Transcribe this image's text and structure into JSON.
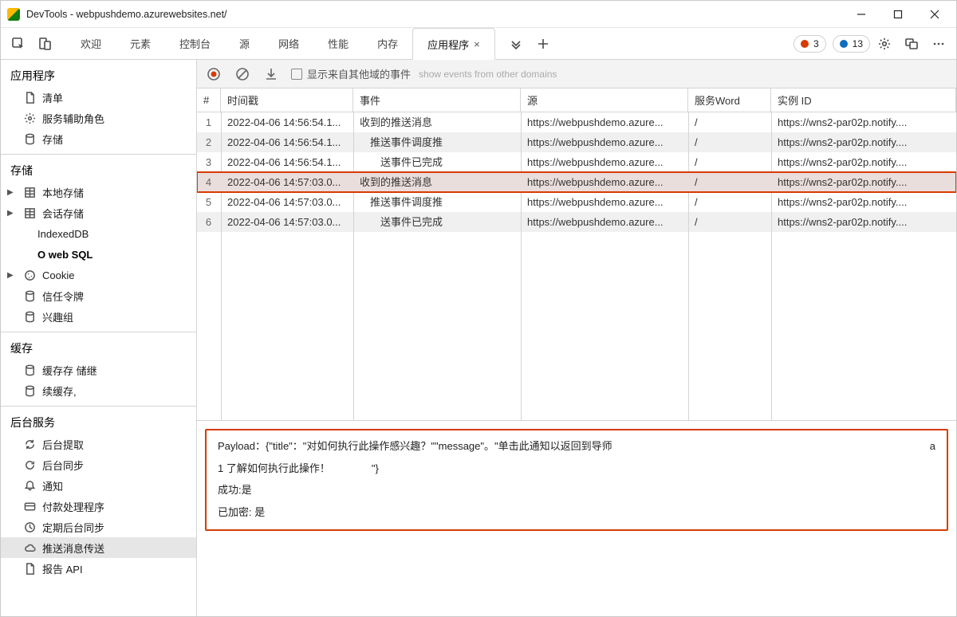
{
  "title": "DevTools - webpushdemo.azurewebsites.net/",
  "tabs": {
    "items": [
      "欢迎",
      "元素",
      "控制台",
      "源",
      "网络",
      "性能",
      "内存",
      "应用程序"
    ],
    "activeIndex": 7
  },
  "status": {
    "errors": "3",
    "info": "13"
  },
  "sidebar": {
    "app": {
      "heading": "应用程序",
      "manifest": "清单",
      "service_workers": "服务辅助角色",
      "storage": "存储"
    },
    "storage": {
      "heading": "存储",
      "local_storage": "本地存储",
      "session_storage": "会话存储",
      "indexeddb": "IndexedDB",
      "web_sql": "O web SQL",
      "cookies": "Cookie",
      "trust_tokens": "信任令牌",
      "interest_groups": "兴趣组"
    },
    "cache": {
      "heading": "缓存",
      "cache_storage": "缓存存 储继",
      "app_cache": "续缓存,"
    },
    "bg": {
      "heading": "后台服务",
      "background_fetch": "后台提取",
      "background_sync": "后台同步",
      "notifications": "通知",
      "payment_handler": "付款处理程序",
      "periodic_bg_sync": "定期后台同步",
      "push_messaging": "推送消息传送",
      "reporting_api": "报告 API"
    }
  },
  "subtoolbar": {
    "show_other_domains": "显示来自其他域的事件",
    "ghost": "show events from other domains"
  },
  "columns": {
    "num": "#",
    "ts": "时间戳",
    "event": "事件",
    "origin": "源",
    "sw": "服务Word",
    "instance": "实例 ID"
  },
  "rows": [
    {
      "n": "1",
      "ts": "2022-04-06 14:56:54.1...",
      "event": "收到的推送消息",
      "origin": "https://webpushdemo.azure...",
      "sw": "/",
      "instance": "https://wns2-par02p.notify....",
      "hl": false
    },
    {
      "n": "2",
      "ts": "2022-04-06 14:56:54.1...",
      "event": "　推送事件调度推",
      "origin": "https://webpushdemo.azure...",
      "sw": "/",
      "instance": "https://wns2-par02p.notify....",
      "hl": false
    },
    {
      "n": "3",
      "ts": "2022-04-06 14:56:54.1...",
      "event": "　　送事件已完成",
      "origin": "https://webpushdemo.azure...",
      "sw": "/",
      "instance": "https://wns2-par02p.notify....",
      "hl": false
    },
    {
      "n": "4",
      "ts": "2022-04-06 14:57:03.0...",
      "event": "收到的推送消息",
      "origin": "https://webpushdemo.azure...",
      "sw": "/",
      "instance": "https://wns2-par02p.notify....",
      "hl": true
    },
    {
      "n": "5",
      "ts": "2022-04-06 14:57:03.0...",
      "event": "　推送事件调度推",
      "origin": "https://webpushdemo.azure...",
      "sw": "/",
      "instance": "https://wns2-par02p.notify....",
      "hl": false
    },
    {
      "n": "6",
      "ts": "2022-04-06 14:57:03.0...",
      "event": "　　送事件已完成",
      "origin": "https://webpushdemo.azure...",
      "sw": "/",
      "instance": "https://wns2-par02p.notify....",
      "hl": false
    }
  ],
  "detail": {
    "payload_label": "Payload：",
    "payload_value": "{\"title\"：\"对如何执行此操作感兴趣？\"\"message\"。\"单击此通知以返回到导师",
    "payload_tail_a": "a",
    "payload_line2": "1 了解如何执行此操作！    \"}",
    "success": "成功:是",
    "encrypted": "已加密: 是"
  }
}
